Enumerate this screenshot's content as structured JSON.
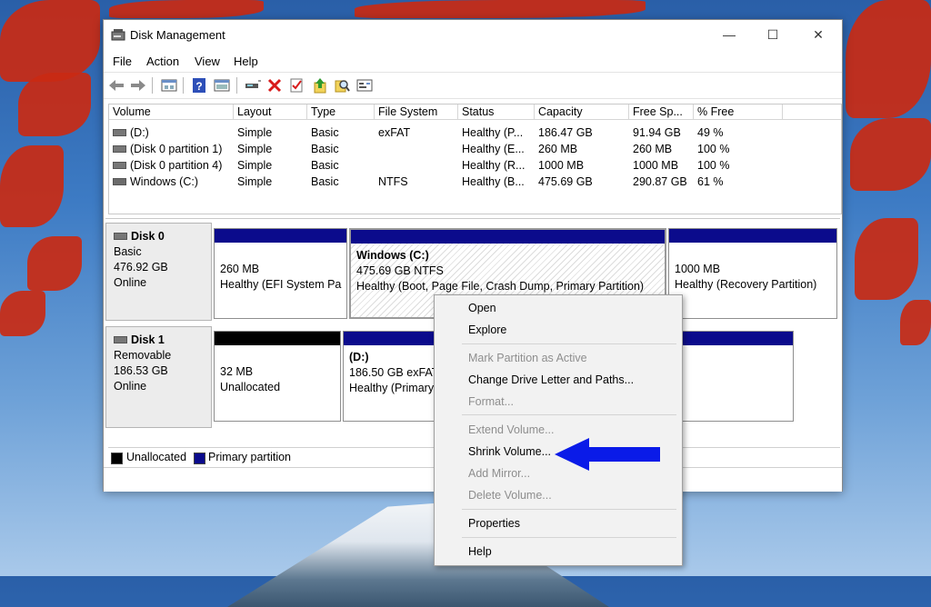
{
  "window": {
    "title": "Disk Management",
    "app_icon": "disk-management-icon"
  },
  "controls": {
    "minimize": "—",
    "maximize": "☐",
    "close": "✕"
  },
  "menu": [
    "File",
    "Action",
    "View",
    "Help"
  ],
  "toolbar": [
    "back-icon",
    "forward-icon",
    "properties-icon",
    "help-icon",
    "view-icon",
    "connect-icon",
    "delete-icon",
    "check-icon",
    "import-icon",
    "search-icon",
    "settings-icon"
  ],
  "volume_list": {
    "columns": [
      "Volume",
      "Layout",
      "Type",
      "File System",
      "Status",
      "Capacity",
      "Free Sp...",
      "% Free"
    ],
    "rows": [
      {
        "volume": "(D:)",
        "layout": "Simple",
        "type": "Basic",
        "fs": "exFAT",
        "status": "Healthy (P...",
        "capacity": "186.47 GB",
        "free": "91.94 GB",
        "pct": "49 %"
      },
      {
        "volume": "(Disk 0 partition 1)",
        "layout": "Simple",
        "type": "Basic",
        "fs": "",
        "status": "Healthy (E...",
        "capacity": "260 MB",
        "free": "260 MB",
        "pct": "100 %"
      },
      {
        "volume": "(Disk 0 partition 4)",
        "layout": "Simple",
        "type": "Basic",
        "fs": "",
        "status": "Healthy (R...",
        "capacity": "1000 MB",
        "free": "1000 MB",
        "pct": "100 %"
      },
      {
        "volume": "Windows (C:)",
        "layout": "Simple",
        "type": "Basic",
        "fs": "NTFS",
        "status": "Healthy (B...",
        "capacity": "475.69 GB",
        "free": "290.87 GB",
        "pct": "61 %"
      }
    ]
  },
  "disks": [
    {
      "name": "Disk 0",
      "kind": "Basic",
      "size": "476.92 GB",
      "state": "Online",
      "partitions": [
        {
          "title": "",
          "size": "260 MB",
          "status": "Healthy (EFI System Pa"
        },
        {
          "title": "Windows  (C:)",
          "size": "475.69 GB NTFS",
          "status": "Healthy (Boot, Page File, Crash Dump, Primary Partition)"
        },
        {
          "title": "",
          "size": "1000 MB",
          "status": "Healthy (Recovery Partition)"
        }
      ]
    },
    {
      "name": "Disk 1",
      "kind": "Removable",
      "size": "186.53 GB",
      "state": "Online",
      "partitions": [
        {
          "title": "",
          "size": "32 MB",
          "status": "Unallocated"
        },
        {
          "title": "(D:)",
          "size": "186.50 GB exFAT",
          "status": "Healthy (Primary"
        }
      ]
    }
  ],
  "legend": {
    "unallocated": "Unallocated",
    "primary": "Primary partition",
    "unallocated_color": "#000000",
    "primary_color": "#0b0b8c"
  },
  "context_menu": {
    "items": [
      {
        "label": "Open",
        "enabled": true
      },
      {
        "label": "Explore",
        "enabled": true
      },
      {
        "label": "Mark Partition as Active",
        "enabled": false
      },
      {
        "label": "Change Drive Letter and Paths...",
        "enabled": true
      },
      {
        "label": "Format...",
        "enabled": false
      },
      {
        "label": "Extend Volume...",
        "enabled": false
      },
      {
        "label": "Shrink Volume...",
        "enabled": true
      },
      {
        "label": "Add Mirror...",
        "enabled": false
      },
      {
        "label": "Delete Volume...",
        "enabled": false
      },
      {
        "label": "Properties",
        "enabled": true
      },
      {
        "label": "Help",
        "enabled": true
      }
    ]
  },
  "annotation": {
    "arrow_color": "#0a1be8",
    "points_to": "Shrink Volume..."
  }
}
